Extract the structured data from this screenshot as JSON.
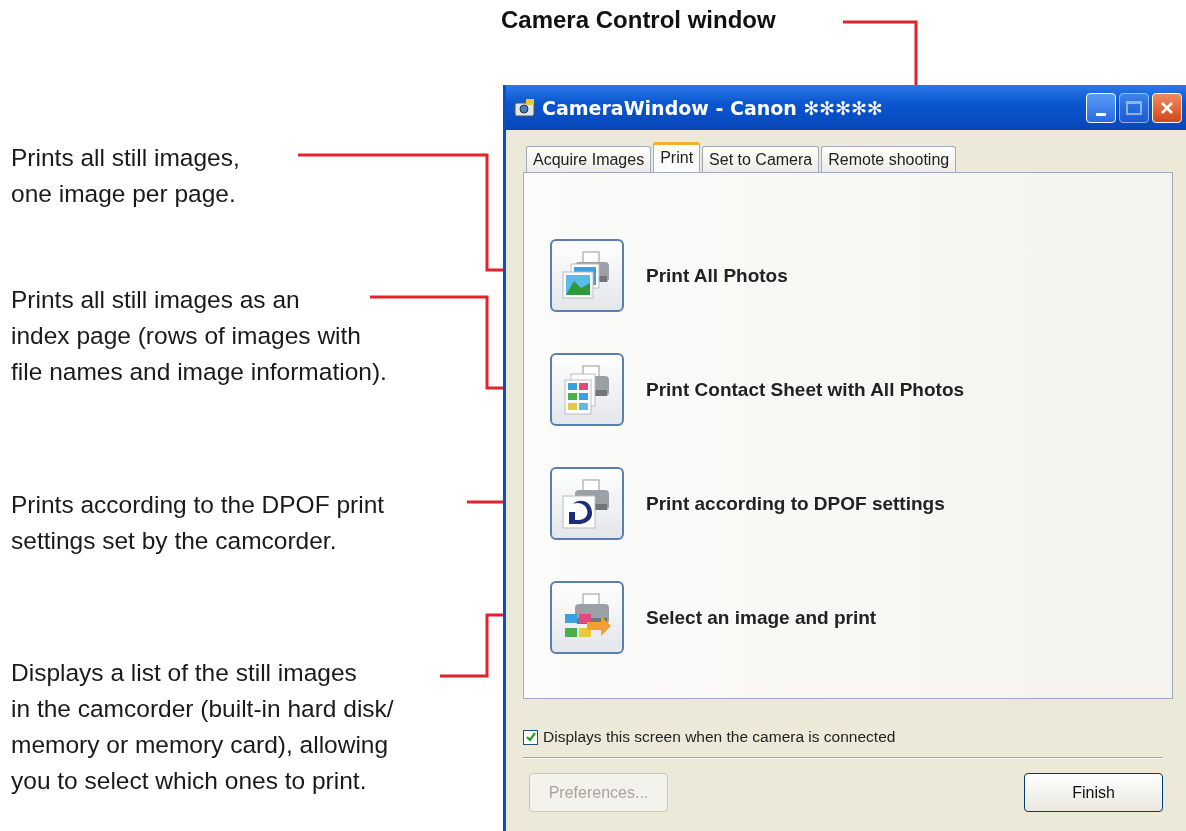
{
  "figure_title": "Camera Control window",
  "callouts": [
    {
      "text": "Prints all still images,\none image per page."
    },
    {
      "text": "Prints all still images as an\nindex page (rows of images with\nfile names and image information)."
    },
    {
      "text": "Prints according to the DPOF print\nsettings set by the camcorder."
    },
    {
      "text": "Displays a list of the still images\nin the camcorder (built-in hard disk/\nmemory or memory card), allowing\nyou to select which ones to print."
    }
  ],
  "window": {
    "title": "CameraWindow - Canon ✻✻✻✻✻",
    "tabs": [
      {
        "label": "Acquire Images",
        "selected": false
      },
      {
        "label": "Print",
        "selected": true
      },
      {
        "label": "Set to Camera",
        "selected": false
      },
      {
        "label": "Remote shooting",
        "selected": false
      }
    ],
    "actions": [
      {
        "kind": "all",
        "label": "Print All Photos"
      },
      {
        "kind": "contact",
        "label": "Print Contact Sheet with All Photos"
      },
      {
        "kind": "dpof",
        "label": "Print according to DPOF settings"
      },
      {
        "kind": "select",
        "label": "Select an image and print"
      }
    ],
    "checkbox": {
      "label": "Displays this screen when the camera is connected",
      "checked": true
    },
    "buttons": [
      {
        "label": "Preferences...",
        "disabled": true
      },
      {
        "label": "Finish",
        "disabled": false
      }
    ]
  }
}
